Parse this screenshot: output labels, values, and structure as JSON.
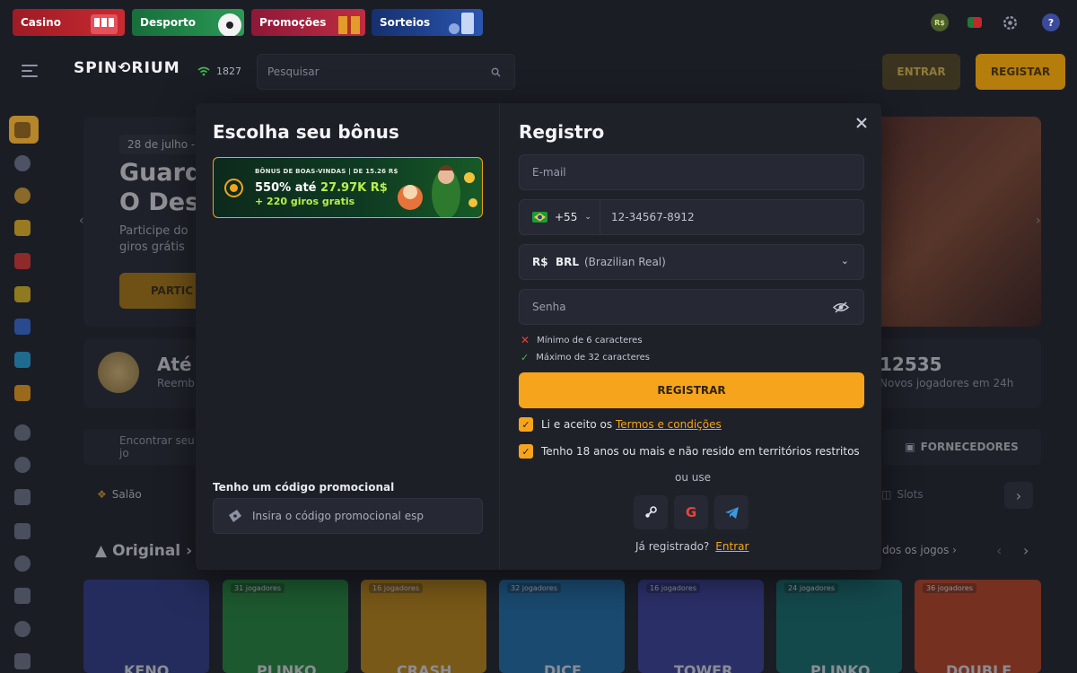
{
  "top_tabs": [
    {
      "label": "Casino",
      "color": "#b41e28"
    },
    {
      "label": "Desporto",
      "color": "#1f8a4a"
    },
    {
      "label": "Promoções",
      "color": "#b02040"
    },
    {
      "label": "Sorteios",
      "color": "#1b3a8c"
    }
  ],
  "header": {
    "logo": "SPIN⟲RIUM",
    "online_count": "1827",
    "search_placeholder": "Pesquisar",
    "login_label": "ENTRAR",
    "register_label": "REGISTAR",
    "currency_badge": "R$"
  },
  "background": {
    "hero_date": "28 de julho -",
    "hero_title_line1": "Guard",
    "hero_title_line2": "O Desa",
    "hero_sub_line1": "Participe do",
    "hero_sub_line2": "giros grátis",
    "hero_button": "PARTIC",
    "stat_left_big": "Até 2",
    "stat_left_small": "Reemb",
    "stat_right_big": "12535",
    "stat_right_small": "Novos jogadores em 24h",
    "game_search": "Encontrar seu jo",
    "providers": "FORNECEDORES",
    "lobby": "Salão",
    "slots": "Slots",
    "original": "Original",
    "all_games": "dos os jogos",
    "cards": [
      {
        "players": "",
        "title": "KENO",
        "color": "#2b3a8a"
      },
      {
        "players": "31 jogadores",
        "title": "PLINKO",
        "color": "#1f8a3a"
      },
      {
        "players": "16 jogadores",
        "title": "CRASH",
        "color": "#c78a10"
      },
      {
        "players": "32 jogadores",
        "title": "DICE",
        "color": "#1b6fb0"
      },
      {
        "players": "16 jogadores",
        "title": "TOWER",
        "color": "#3a3fa0"
      },
      {
        "players": "24 jogadores",
        "title": "PLINKO",
        "color": "#0f6e6e"
      },
      {
        "players": "36 jogadores",
        "title": "DOUBLE",
        "color": "#c0401e"
      }
    ]
  },
  "modal": {
    "bonus_title": "Escolha seu bônus",
    "bonus_card": {
      "top_line": "BÔNUS DE BOAS-VINDAS | DE 15.26 R$",
      "main_prefix": "550% até ",
      "main_amount": "27.97K R$",
      "spins": "+ 220 giros gratis"
    },
    "promo_label": "Tenho um código promocional",
    "promo_placeholder": "Insira o código promocional esp",
    "register_title": "Registro",
    "email_placeholder": "E-mail",
    "phone_code": "+55",
    "phone_placeholder": "12-34567-8912",
    "currency_code": "R$  BRL",
    "currency_name": "(Brazilian Real)",
    "password_placeholder": "Senha",
    "rules": [
      {
        "text": "Mínimo de 6 caracteres",
        "ok": false
      },
      {
        "text": "Máximo de 32 caracteres",
        "ok": true
      }
    ],
    "submit_label": "REGISTRAR",
    "terms_prefix": "Li e aceito os ",
    "terms_link": "Termos e condições",
    "age_text": "Tenho 18 anos ou mais e não resido em territórios restritos",
    "or_use": "ou use",
    "already_registered": "Já registrado?",
    "login_link": "Entrar"
  }
}
